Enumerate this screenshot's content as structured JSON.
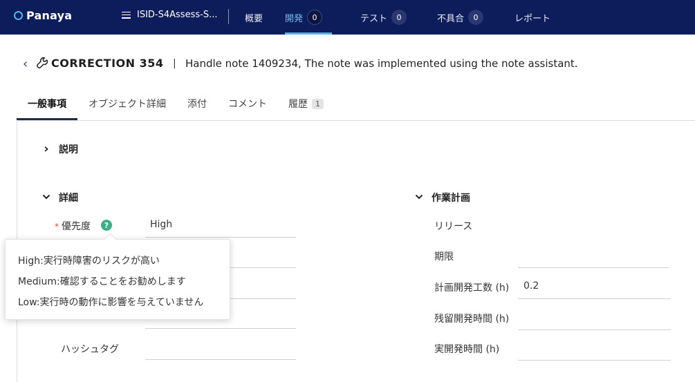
{
  "app": {
    "logo": "Panaya"
  },
  "project": {
    "name": "ISID-S4Assess-S..."
  },
  "nav": {
    "tabs": [
      {
        "label": "概要",
        "count": null
      },
      {
        "label": "開発",
        "count": "0"
      },
      {
        "label": "テスト",
        "count": "0"
      },
      {
        "label": "不具合",
        "count": "0"
      },
      {
        "label": "レポート",
        "count": null
      }
    ]
  },
  "page": {
    "id": "CORRECTION 354",
    "separator": "|",
    "title": "Handle note 1409234, The note was implemented using the note assistant."
  },
  "tabs": {
    "items": [
      {
        "label": "一般事項"
      },
      {
        "label": "オブジェクト詳細"
      },
      {
        "label": "添付"
      },
      {
        "label": "コメント"
      },
      {
        "label": "履歴",
        "badge": "1"
      }
    ]
  },
  "sections": {
    "description": {
      "title": "説明",
      "chevron": "›"
    },
    "details": {
      "title": "詳細",
      "chevron": "⌄",
      "priority": {
        "required_mark": "*",
        "label": "優先度",
        "help": "?",
        "value": "High"
      },
      "hashtag": {
        "label": "ハッシュタグ"
      }
    },
    "workplan": {
      "title": "作業計画",
      "chevron": "⌄",
      "release": {
        "label": "リリース"
      },
      "due": {
        "label": "期限"
      },
      "planned_effort": {
        "label": "計画開発工数 (h)",
        "value": "0.2"
      },
      "remaining": {
        "label": "残留開発時間 (h)"
      },
      "actual": {
        "label": "実開発時間 (h)"
      }
    }
  },
  "tooltip": {
    "lines": [
      "High:実行時障害のリスクが高い",
      "Medium:確認することをお勧めします",
      "Low:実行時の動作に影響を与えていません"
    ]
  }
}
